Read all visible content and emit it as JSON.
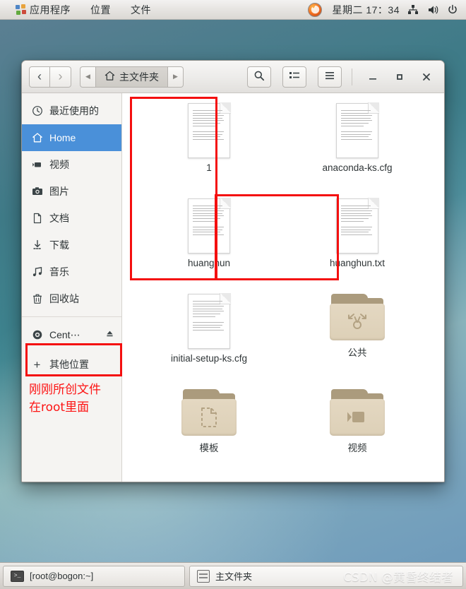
{
  "top_panel": {
    "menu": [
      {
        "label": "应用程序",
        "icon": "applications-icon"
      },
      {
        "label": "位置",
        "icon": null
      },
      {
        "label": "文件",
        "icon": null
      }
    ],
    "firefox_icon": "firefox-icon",
    "clock": "星期二 17：34",
    "tray": [
      {
        "name": "network-icon",
        "glyph": "network"
      },
      {
        "name": "volume-icon",
        "glyph": "volume"
      },
      {
        "name": "power-icon",
        "glyph": "power"
      }
    ]
  },
  "window": {
    "nav": {
      "back": "‹",
      "forward": "›"
    },
    "path": {
      "prev_arrow": "◀",
      "next_arrow": "▶",
      "crumb": "主文件夹",
      "home_icon": "home-icon"
    },
    "tools": [
      {
        "name": "search-button",
        "icon": "search-icon"
      },
      {
        "name": "view-list-button",
        "icon": "list-view-icon"
      },
      {
        "name": "menu-button",
        "icon": "hamburger-menu-icon"
      }
    ],
    "controls": {
      "minimize": "—",
      "maximize": "□",
      "close": "✕"
    }
  },
  "sidebar": {
    "items": [
      {
        "label": "最近使用的",
        "icon": "clock-icon",
        "active": false
      },
      {
        "label": "Home",
        "icon": "home-icon",
        "active": true
      },
      {
        "label": "视频",
        "icon": "video-icon",
        "active": false
      },
      {
        "label": "图片",
        "icon": "camera-icon",
        "active": false
      },
      {
        "label": "文档",
        "icon": "document-icon",
        "active": false
      },
      {
        "label": "下载",
        "icon": "download-icon",
        "active": false
      },
      {
        "label": "音乐",
        "icon": "music-icon",
        "active": false
      },
      {
        "label": "回收站",
        "icon": "trash-icon",
        "active": false
      }
    ],
    "device": {
      "label": "Cent⋯",
      "icon": "disc-icon",
      "eject": "eject-icon"
    },
    "other_locations": {
      "label": "其他位置",
      "icon": "plus-icon"
    },
    "annotation": {
      "line1": "刚刚所创文件",
      "line2": "在root里面",
      "color": "#fd1414"
    }
  },
  "files": [
    {
      "name": "1",
      "type": "document"
    },
    {
      "name": "anaconda-ks.cfg",
      "type": "document"
    },
    {
      "name": "huanghun",
      "type": "document"
    },
    {
      "name": "huanghun.txt",
      "type": "document"
    },
    {
      "name": "initial-setup-ks.cfg",
      "type": "document"
    },
    {
      "name": "公共",
      "type": "folder",
      "emblem": "share-icon"
    },
    {
      "name": "模板",
      "type": "folder",
      "emblem": "template-icon"
    },
    {
      "name": "视频",
      "type": "folder",
      "emblem": "video-icon"
    }
  ],
  "highlight_color": "#f40f0f",
  "taskbar": {
    "terminal": {
      "label": "[root@bogon:~]",
      "icon": "terminal-icon"
    },
    "files": {
      "label": "主文件夹",
      "icon": "files-icon"
    }
  },
  "watermark": "CSDN @黄昏终结者"
}
